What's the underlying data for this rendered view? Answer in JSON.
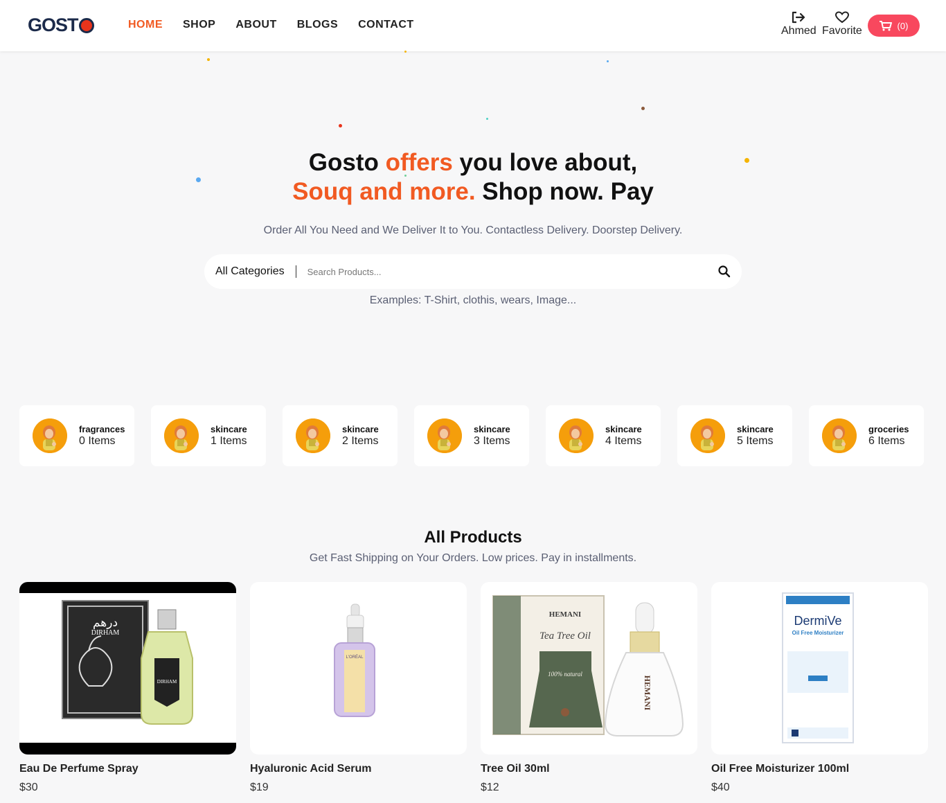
{
  "header": {
    "logo": "GOSTO",
    "nav": [
      {
        "label": "HOME",
        "active": true
      },
      {
        "label": "SHOP",
        "active": false
      },
      {
        "label": "ABOUT",
        "active": false
      },
      {
        "label": "BLOGS",
        "active": false
      },
      {
        "label": "CONTACT",
        "active": false
      }
    ],
    "user_label": "Ahmed",
    "favorite_label": "Favorite",
    "cart_count": "(0)"
  },
  "hero": {
    "title_part1": "Gosto ",
    "title_accent1": "offers",
    "title_part2": " you love about,",
    "title_accent2": "Souq and more.",
    "title_part3": " Shop now. Pay",
    "subtitle": "Order All You Need and We Deliver It to You. Contactless Delivery. Doorstep Delivery.",
    "search_category": "All Categories",
    "search_placeholder": "Search Products...",
    "examples": "Examples: T-Shirt, clothis, wears, Image..."
  },
  "categories": [
    {
      "name": "fragrances",
      "count": "0 Items"
    },
    {
      "name": "skincare",
      "count": "1 Items"
    },
    {
      "name": "skincare",
      "count": "2 Items"
    },
    {
      "name": "skincare",
      "count": "3 Items"
    },
    {
      "name": "skincare",
      "count": "4 Items"
    },
    {
      "name": "skincare",
      "count": "5 Items"
    },
    {
      "name": "groceries",
      "count": "6 Items"
    }
  ],
  "products_section": {
    "title": "All Products",
    "subtitle": "Get Fast Shipping on Your Orders. Low prices. Pay in installments."
  },
  "products": [
    {
      "name": "Eau De Perfume Spray",
      "price": "$30",
      "image_label": "DIRHAM",
      "image_label_ar": "درهم"
    },
    {
      "name": "Hyaluronic Acid Serum",
      "price": "$19",
      "image_label": "L'ORÉAL"
    },
    {
      "name": "Tree Oil 30ml",
      "price": "$12",
      "image_label": "HEMANI",
      "image_sub": "Tea Tree Oil",
      "image_sub2": "100% natural"
    },
    {
      "name": "Oil Free Moisturizer 100ml",
      "price": "$40",
      "image_label": "DermiVe",
      "image_sub": "Oil Free Moisturizer"
    }
  ],
  "colors": {
    "accent": "#f15a22",
    "cart": "#f8485e",
    "brand": "#1b2a4a"
  }
}
